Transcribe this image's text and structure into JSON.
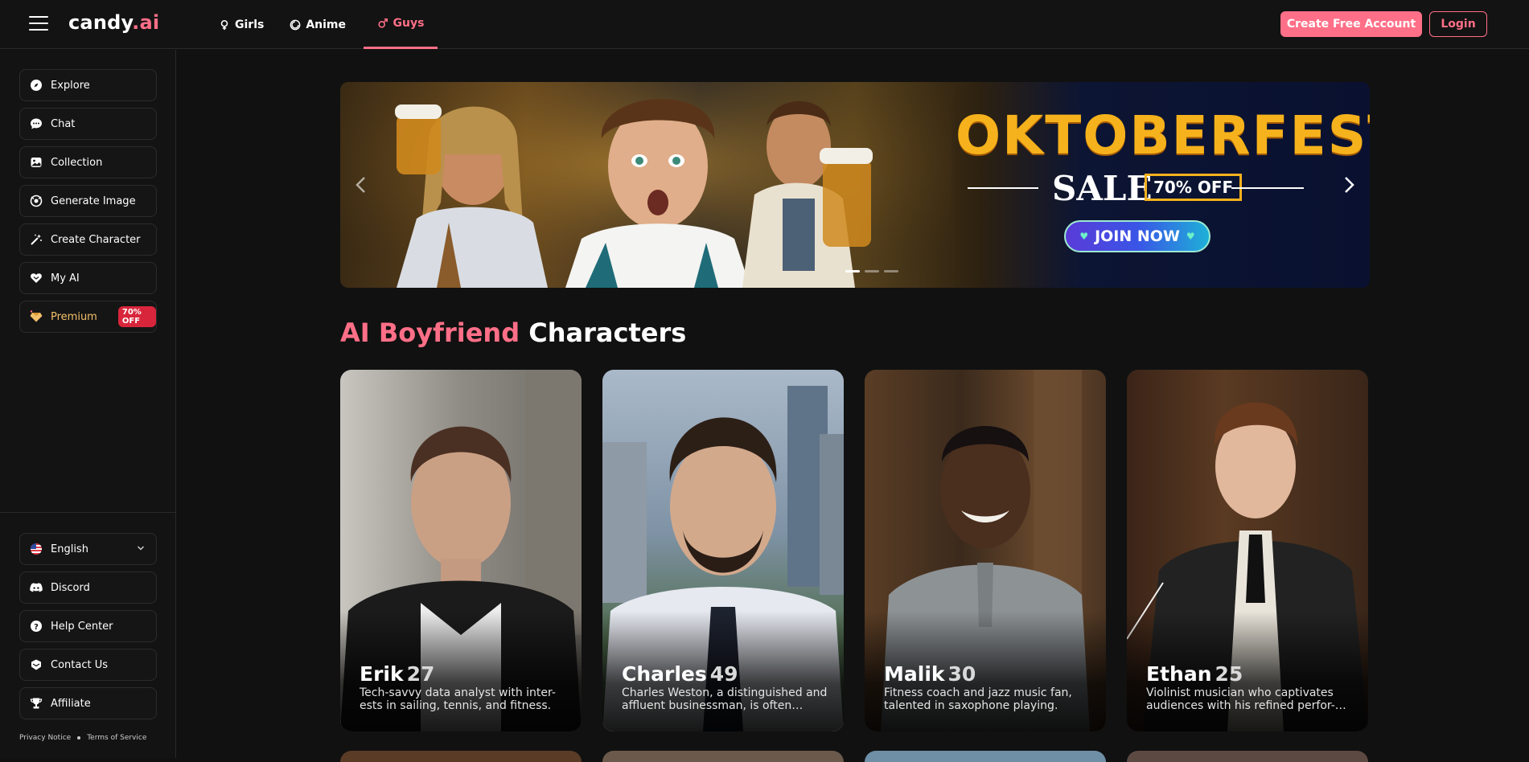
{
  "header": {
    "logo_text": "candy",
    "logo_suffix": ".ai",
    "tabs": [
      {
        "label": "Girls",
        "icon": "female-icon"
      },
      {
        "label": "Anime",
        "icon": "anime-icon"
      },
      {
        "label": "Guys",
        "icon": "male-icon",
        "active": true
      }
    ],
    "create_account_label": "Create Free Account",
    "login_label": "Login"
  },
  "sidebar": {
    "items": [
      {
        "label": "Explore",
        "icon": "compass-icon"
      },
      {
        "label": "Chat",
        "icon": "chat-icon"
      },
      {
        "label": "Collection",
        "icon": "collection-icon"
      },
      {
        "label": "Generate Image",
        "icon": "image-icon"
      },
      {
        "label": "Create Character",
        "icon": "magic-wand-icon"
      },
      {
        "label": "My AI",
        "icon": "heart-icon"
      },
      {
        "label": "Premium",
        "icon": "diamond-icon",
        "badge": "70% OFF"
      }
    ],
    "bottom_items": [
      {
        "label": "English",
        "icon": "flag-icon"
      },
      {
        "label": "Discord",
        "icon": "discord-icon"
      },
      {
        "label": "Help Center",
        "icon": "help-icon"
      },
      {
        "label": "Contact Us",
        "icon": "contact-icon"
      },
      {
        "label": "Affiliate",
        "icon": "trophy-icon"
      }
    ],
    "privacy_label": "Privacy Notice",
    "terms_label": "Terms of Service"
  },
  "banner": {
    "title": "OKTOBERFEST",
    "sale_label": "SALE",
    "discount_label": "70% OFF",
    "cta_label": "JOIN NOW"
  },
  "section": {
    "title_highlight": "AI Boyfriend",
    "title_rest": "Characters"
  },
  "characters": [
    {
      "name": "Erik",
      "age": "27",
      "description": "Tech-savvy data analyst with inter-ests in sailing, tennis, and fitness."
    },
    {
      "name": "Charles",
      "age": "49",
      "description": "Charles Weston, a distinguished and affluent businessman, is often…"
    },
    {
      "name": "Malik",
      "age": "30",
      "description": "Fitness coach and jazz music fan, talented in saxophone playing."
    },
    {
      "name": "Ethan",
      "age": "25",
      "description": "Violinist musician who captivates audiences with his refined perfor-…"
    }
  ],
  "colors": {
    "accent": "#ff6f87",
    "premium": "#f3c06b",
    "badge": "#d8253b",
    "background": "#111111"
  }
}
